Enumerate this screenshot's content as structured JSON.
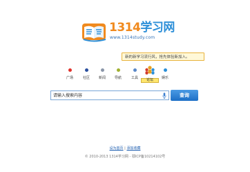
{
  "logo": {
    "number": "1314",
    "name_cn": "学习网",
    "url": "www.1314study.com"
  },
  "notice": {
    "text": "新的新学习流行风，抢先体验新加入。"
  },
  "nav": {
    "items": [
      {
        "label": "广场",
        "color": "#e0322c"
      },
      {
        "label": "社区",
        "color": "#2a4f9e"
      },
      {
        "label": "新闻",
        "color": "#8a96a8"
      },
      {
        "label": "导航",
        "color": "#a0b030"
      },
      {
        "label": "工具",
        "color": "#5a88c8"
      },
      {
        "label": "论坛",
        "color": "#e8a020",
        "active": true
      },
      {
        "label": "娱乐",
        "color": "#2a8fd8"
      }
    ]
  },
  "search": {
    "placeholder": "请输入搜索内容",
    "button_label": "查询"
  },
  "footer": {
    "set_home": "设为首页",
    "separator": "|",
    "add_favorite": "添加收藏",
    "copyright": "© 2010-2013 1314学习网 -",
    "icp": "鄂ICP备10214102号"
  },
  "colors": {
    "accent": "#2d8fd8",
    "brand_orange": "#f08a1e"
  }
}
